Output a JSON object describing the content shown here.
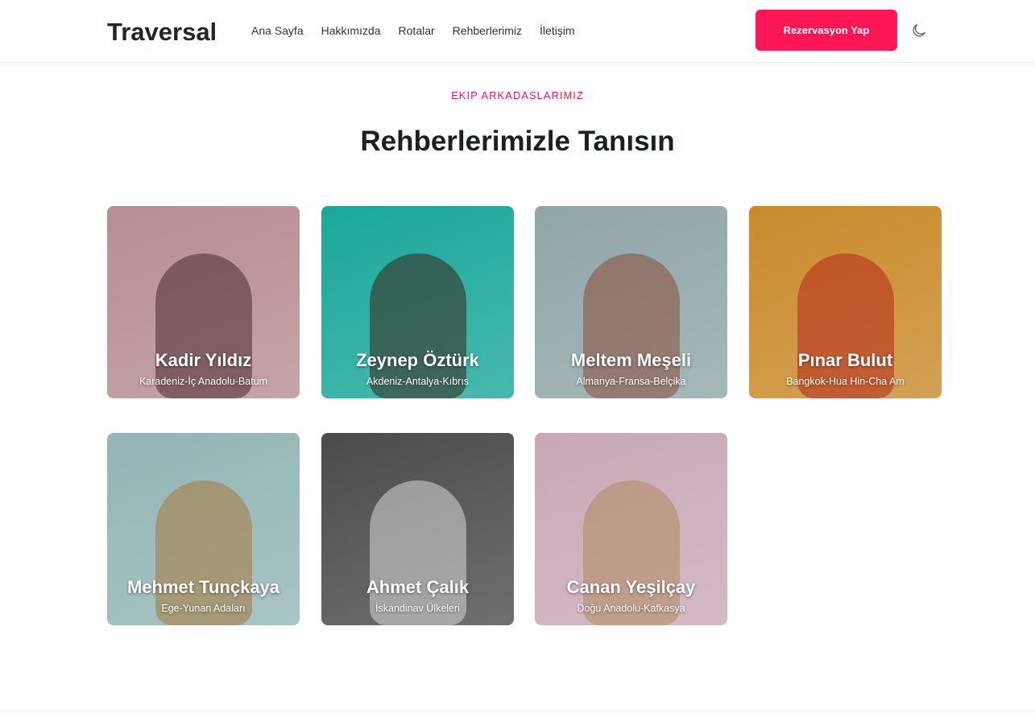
{
  "header": {
    "logo": "Traversal",
    "nav": [
      "Ana Sayfa",
      "Hakkımızda",
      "Rotalar",
      "Rehberlerimiz",
      "İletişim"
    ],
    "cta": "Rezervasyon Yap",
    "theme_icon": "moon-icon"
  },
  "section": {
    "eyebrow": "EKIP ARKADASLARIMIZ",
    "title": "Rehberlerimizle Tanısın"
  },
  "guides": [
    {
      "name": "Kadir Yıldız",
      "route": "Karadeniz-İç Anadolu-Batum",
      "bg": "#b88d91",
      "fg": "#4a2a2c"
    },
    {
      "name": "Zeynep Öztürk",
      "route": "Akdeniz-Antalya-Kıbrıs",
      "bg": "#19a89a",
      "fg": "#3a2418"
    },
    {
      "name": "Meltem Meşeli",
      "route": "Almanya-Fransa-Belçika",
      "bg": "#8fa6a8",
      "fg": "#8a4a38"
    },
    {
      "name": "Pınar Bulut",
      "route": "Bangkok-Hua Hin-Cha Am",
      "bg": "#c98a2a",
      "fg": "#b5261c"
    },
    {
      "name": "Mehmet Tunçkaya",
      "route": "Ege-Yunan Adaları",
      "bg": "#93b5b5",
      "fg": "#a8783a"
    },
    {
      "name": "Ahmet Çalık",
      "route": "İskandinav Ülkeleri",
      "bg": "#4b4b4b",
      "fg": "#d9d9d9"
    },
    {
      "name": "Canan Yeşilçay",
      "route": "Doğu Anadolu-Kafkasya",
      "bg": "#c8a9b6",
      "fg": "#b08a5e"
    }
  ]
}
